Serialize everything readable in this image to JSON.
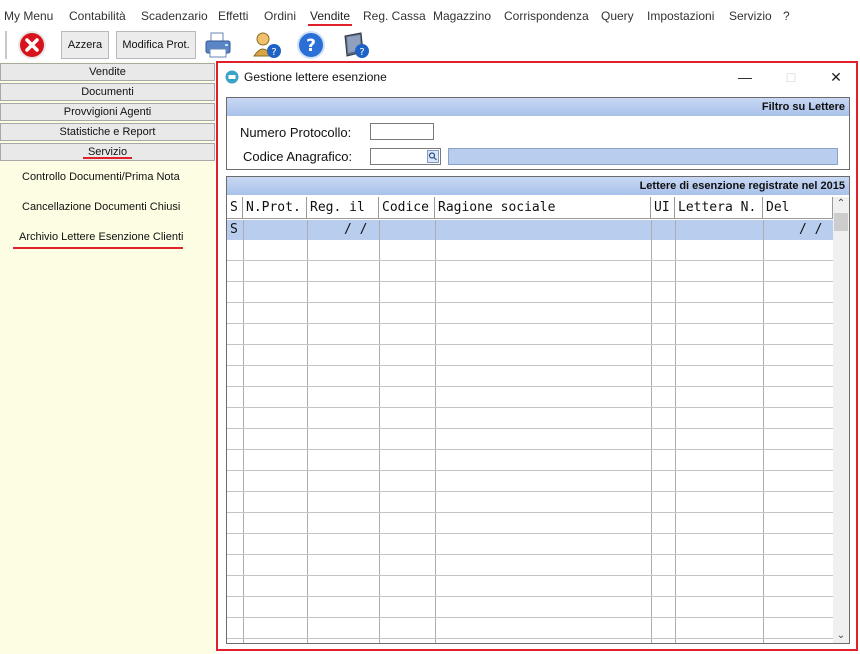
{
  "menu": {
    "items": [
      "My Menu",
      "Contabilità",
      "Scadenzario",
      "Effetti",
      "Ordini",
      "Vendite",
      "Reg. Cassa",
      "Magazzino",
      "Corrispondenza",
      "Query",
      "Impostazioni",
      "Servizio",
      "?"
    ],
    "active": "Vendite"
  },
  "toolbar": {
    "azzera_label": "Azzera",
    "modifica_label": "Modifica Prot."
  },
  "sidebar": {
    "sections": [
      "Vendite",
      "Documenti",
      "Provvigioni Agenti",
      "Statistiche e Report",
      "Servizio"
    ],
    "active_section": "Servizio",
    "links": [
      "Controllo Documenti/Prima Nota",
      "Cancellazione Documenti Chiusi",
      "Archivio Lettere Esenzione Clienti"
    ],
    "active_link": "Archivio Lettere Esenzione Clienti"
  },
  "window": {
    "title": "Gestione lettere esenzione",
    "filter_header": "Filtro su Lettere",
    "numero_protocollo_label": "Numero Protocollo:",
    "codice_anagrafico_label": "Codice Anagrafico:",
    "numero_protocollo_value": "",
    "codice_anagrafico_value": "",
    "grid_header": "Lettere di esenzione registrate nel 2015",
    "columns": [
      "S",
      "N.Prot.",
      "Reg. il",
      "Codice",
      "Ragione sociale",
      "UI",
      "Lettera N.",
      "Del"
    ],
    "first_row": {
      "s": "S",
      "reg_il": "/ /",
      "del": "/ /"
    }
  },
  "colors": {
    "accent_red": "#e0202a",
    "header_blue": "#b9cdee",
    "sidebar_bg": "#fdfde3"
  }
}
